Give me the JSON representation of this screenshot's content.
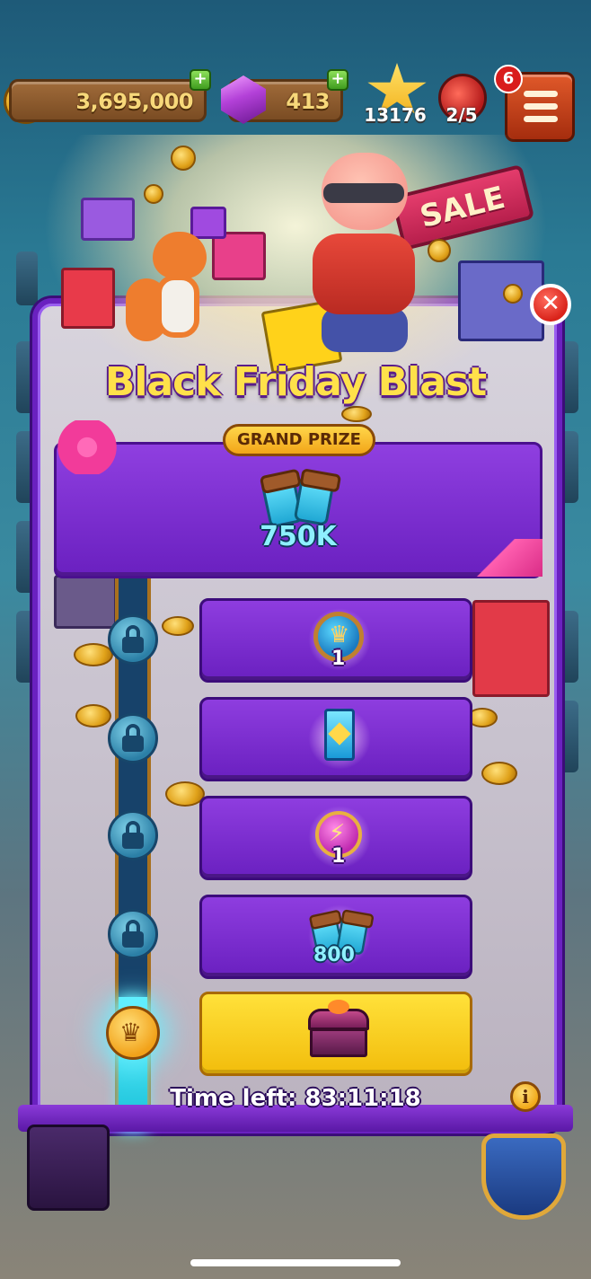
{
  "hud": {
    "coins": "3,695,000",
    "gems": "413",
    "stars": "13176",
    "raids": "2/5",
    "menu_badge": "6",
    "plus_symbol": "+"
  },
  "event": {
    "sale_sign": "SALE",
    "title": "Black Friday Blast",
    "grand_prize_label": "GRAND PRIZE",
    "grand_prize_value": "750K",
    "close_symbol": "✕",
    "info_symbol": "i",
    "timer_text": "Time left: 83:11:18"
  },
  "tiers": [
    {
      "reward": "shield-reward-icon",
      "value": "1",
      "locked": true
    },
    {
      "reward": "card-pack-icon",
      "value": "",
      "locked": true
    },
    {
      "reward": "lightning-card-icon",
      "value": "1",
      "locked": true
    },
    {
      "reward": "spin-booster-icon",
      "value": "800",
      "locked": true
    },
    {
      "reward": "treasure-chest-icon",
      "value": "",
      "locked": false
    }
  ],
  "colors": {
    "popup_border": "#6a21c0",
    "title_yellow": "#ffe14a",
    "tier_purple": "#8e3ddf",
    "final_tier_yellow": "#ffe13a",
    "close_red": "#d9231a"
  }
}
